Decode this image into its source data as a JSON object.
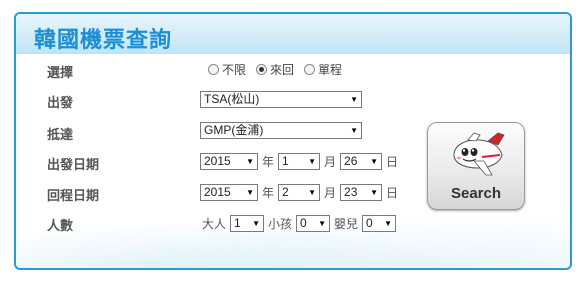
{
  "title": "韓國機票查詢",
  "trip_type": {
    "label": "選擇",
    "options": [
      {
        "label": "不限",
        "selected": false
      },
      {
        "label": "來回",
        "selected": true
      },
      {
        "label": "單程",
        "selected": false
      }
    ]
  },
  "departure": {
    "label": "出發",
    "value": "TSA(松山)"
  },
  "arrival": {
    "label": "抵達",
    "value": "GMP(金浦)"
  },
  "depart_date": {
    "label": "出發日期",
    "year": "2015",
    "month": "1",
    "day": "26"
  },
  "return_date": {
    "label": "回程日期",
    "year": "2015",
    "month": "2",
    "day": "23"
  },
  "date_units": {
    "year": "年",
    "month": "月",
    "day": "日"
  },
  "passengers": {
    "label": "人數",
    "adult_label": "大人",
    "adult": "1",
    "child_label": "小孩",
    "child": "0",
    "infant_label": "嬰兒",
    "infant": "0"
  },
  "search_button": {
    "label": "Search",
    "icon": "airplane-mascot-icon"
  },
  "colors": {
    "accent": "#2b9ad6",
    "title": "#1a8fd4",
    "plane_red": "#d2232a"
  }
}
